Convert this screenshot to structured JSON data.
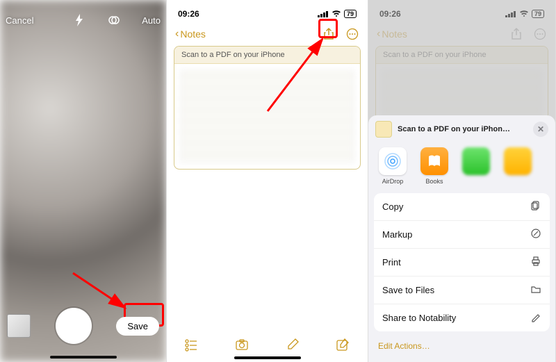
{
  "screen1": {
    "cancel": "Cancel",
    "auto": "Auto",
    "save": "Save"
  },
  "statusbar": {
    "time": "09:26",
    "battery": "79"
  },
  "notes": {
    "back_label": "Notes",
    "card_title": "Scan to a PDF on your iPhone"
  },
  "share": {
    "title": "Scan to a PDF on your iPhon…",
    "apps": {
      "airdrop": "AirDrop",
      "books": "Books"
    },
    "actions": {
      "copy": "Copy",
      "markup": "Markup",
      "print": "Print",
      "save_to_files": "Save to Files",
      "share_notability": "Share to Notability"
    },
    "edit_actions": "Edit Actions…"
  }
}
